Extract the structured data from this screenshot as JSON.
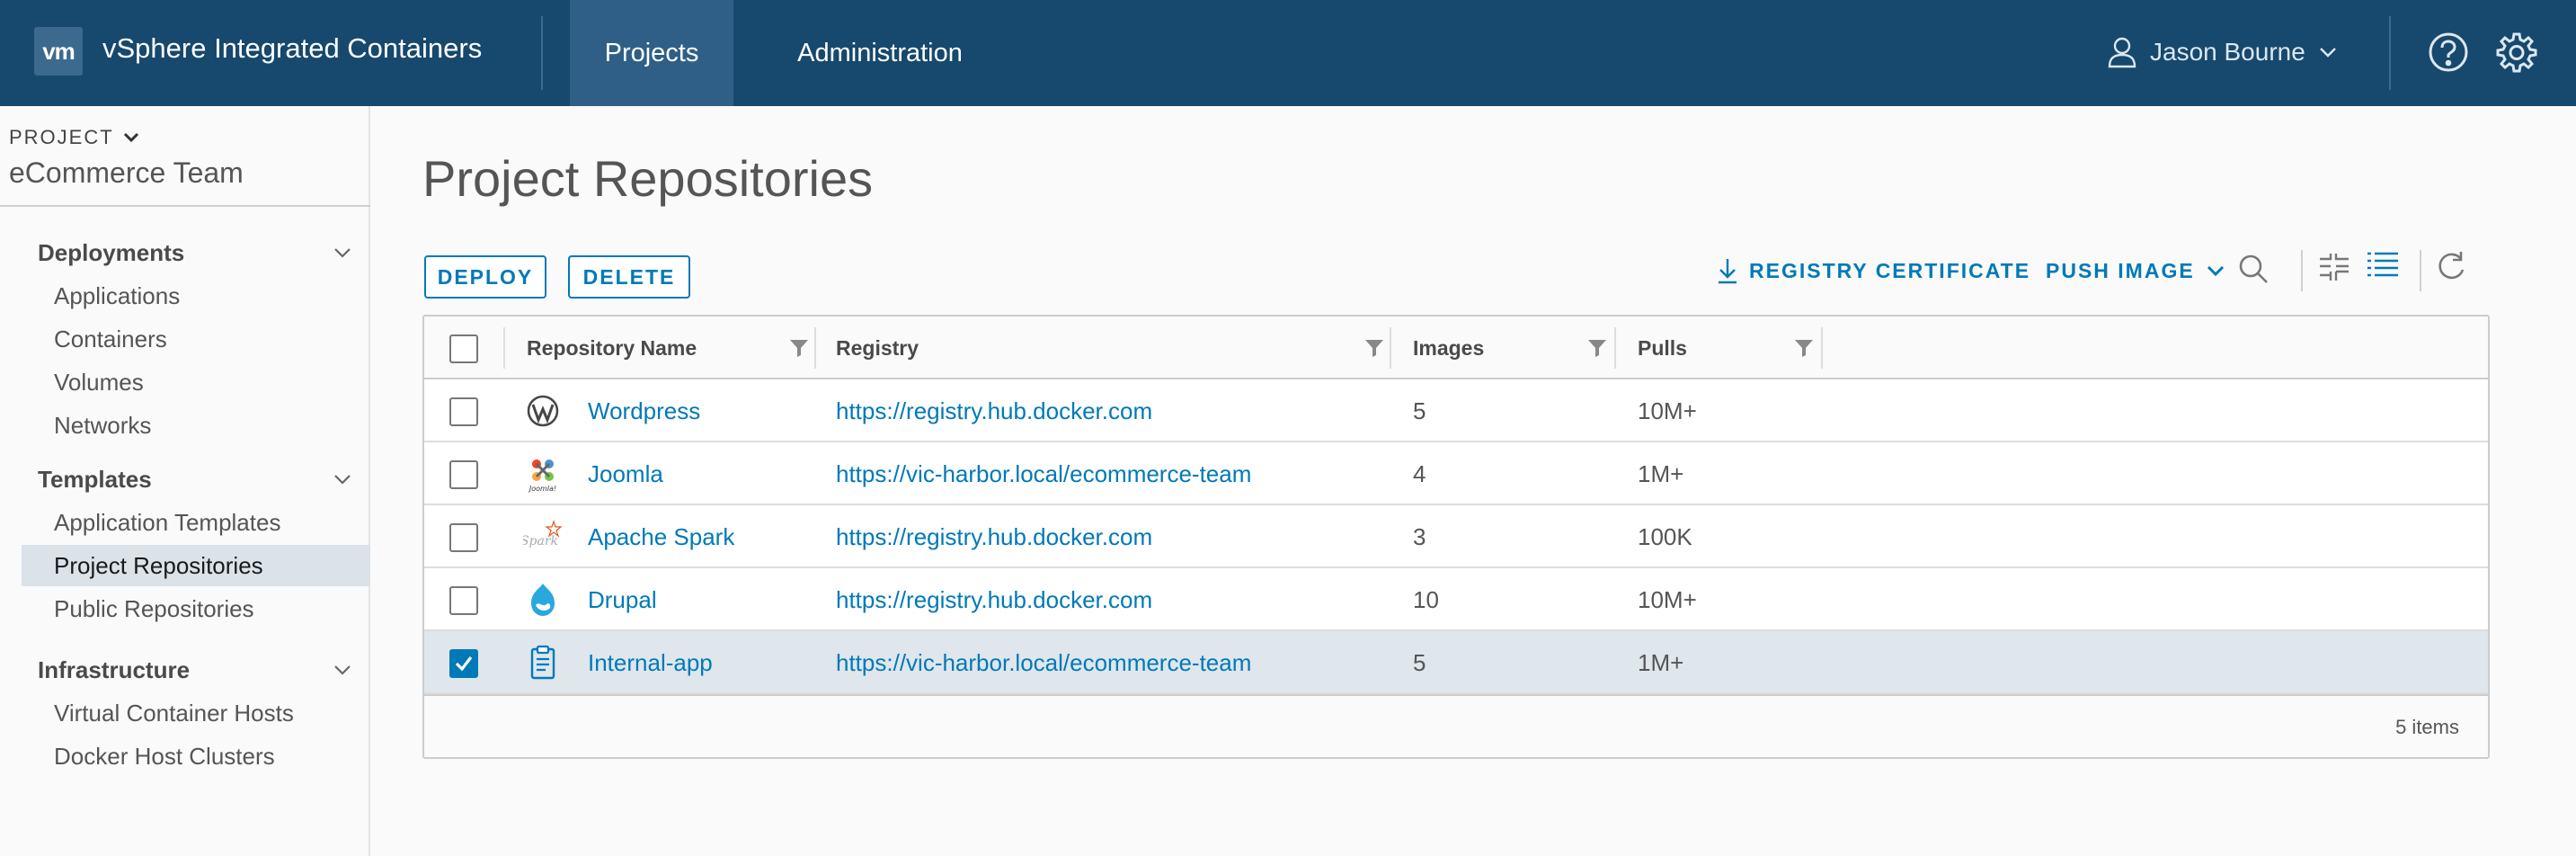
{
  "header": {
    "logo": "vm",
    "app_title": "vSphere Integrated Containers",
    "tabs": [
      {
        "label": "Projects",
        "active": true
      },
      {
        "label": "Administration",
        "active": false
      }
    ],
    "user_name": "Jason Bourne",
    "icons": [
      "user-icon",
      "chevron-down-icon",
      "help-icon",
      "gear-icon"
    ],
    "bg_color": "#17486d"
  },
  "sidebar": {
    "project_label": "PROJECT",
    "project_name": "eCommerce Team",
    "sections": [
      {
        "title": "Deployments",
        "items": [
          "Applications",
          "Containers",
          "Volumes",
          "Networks"
        ]
      },
      {
        "title": "Templates",
        "items": [
          "Application Templates",
          "Project Repositories",
          "Public Repositories"
        ]
      },
      {
        "title": "Infrastructure",
        "items": [
          "Virtual Container Hosts",
          "Docker Host Clusters"
        ]
      }
    ],
    "active_item": "Project Repositories"
  },
  "main": {
    "title": "Project Repositories",
    "buttons": {
      "deploy": "DEPLOY",
      "delete": "DELETE"
    },
    "toolbar": {
      "registry_certificate": "REGISTRY CERTIFICATE",
      "push_image": "PUSH IMAGE",
      "icons": [
        "download-icon",
        "chevron-down-icon",
        "search-icon",
        "grid-view-icon",
        "list-view-icon",
        "refresh-icon"
      ]
    },
    "accent_color": "#0079b8",
    "table": {
      "columns": [
        "Repository Name",
        "Registry",
        "Images",
        "Pulls"
      ],
      "rows": [
        {
          "name": "Wordpress",
          "icon": "wordpress-icon",
          "registry": "https://registry.hub.docker.com",
          "images": "5",
          "pulls": "10M+",
          "checked": false
        },
        {
          "name": "Joomla",
          "icon": "joomla-icon",
          "icon_text": "Joomla!",
          "registry": "https://vic-harbor.local/ecommerce-team",
          "images": "4",
          "pulls": "1M+",
          "checked": false
        },
        {
          "name": "Apache Spark",
          "icon": "spark-icon",
          "icon_text": "Spark",
          "registry": "https://registry.hub.docker.com",
          "images": "3",
          "pulls": "100K",
          "checked": false
        },
        {
          "name": "Drupal",
          "icon": "drupal-icon",
          "registry": "https://registry.hub.docker.com",
          "images": "10",
          "pulls": "10M+",
          "checked": false
        },
        {
          "name": "Internal-app",
          "icon": "clipboard-icon",
          "registry": "https://vic-harbor.local/ecommerce-team",
          "images": "5",
          "pulls": "1M+",
          "checked": true
        }
      ],
      "footer": "5 items"
    }
  }
}
